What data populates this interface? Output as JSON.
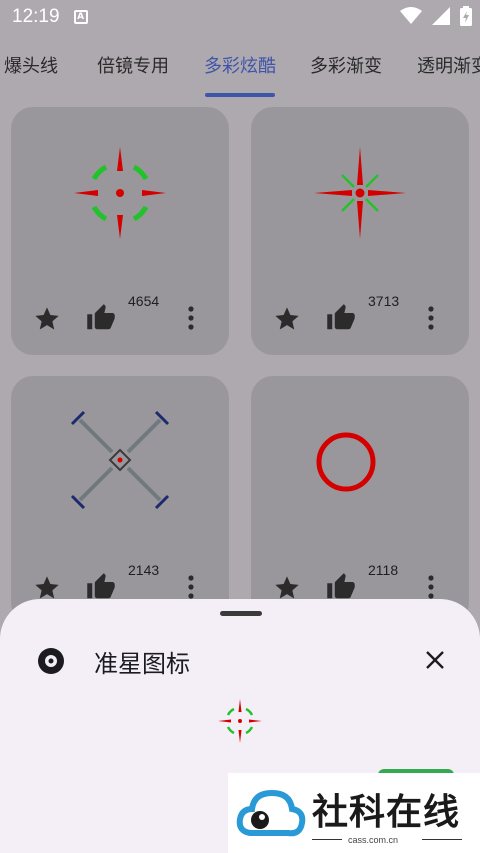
{
  "status_bar": {
    "time": "12:19",
    "notification_letter": "A"
  },
  "tabs": [
    {
      "label": "爆头线"
    },
    {
      "label": "倍镜专用"
    },
    {
      "label": "多彩炫酷"
    },
    {
      "label": "多彩渐变"
    },
    {
      "label": "透明渐变"
    }
  ],
  "active_tab_index": 2,
  "cards": [
    {
      "likes": "4654",
      "crosshair": "green-red-circle-crosshair-icon"
    },
    {
      "likes": "3713",
      "crosshair": "red-green-star-crosshair-icon"
    },
    {
      "likes": "2143",
      "crosshair": "sniper-x-crosshair-icon"
    },
    {
      "likes": "2118",
      "crosshair": "red-ring-crosshair-icon"
    }
  ],
  "sheet": {
    "title": "准星图标",
    "icon": "disc-icon",
    "close_icon": "close-icon"
  },
  "watermark": {
    "brand": "社科在线",
    "url": "cass.com.cn"
  },
  "colors": {
    "accent": "#3f55a8",
    "crosshair_red": "#d40000",
    "crosshair_green": "#22c22b",
    "card_bg": "#9a979c",
    "page_bg": "#ada9ae",
    "sheet_bg": "#f4eff6"
  }
}
